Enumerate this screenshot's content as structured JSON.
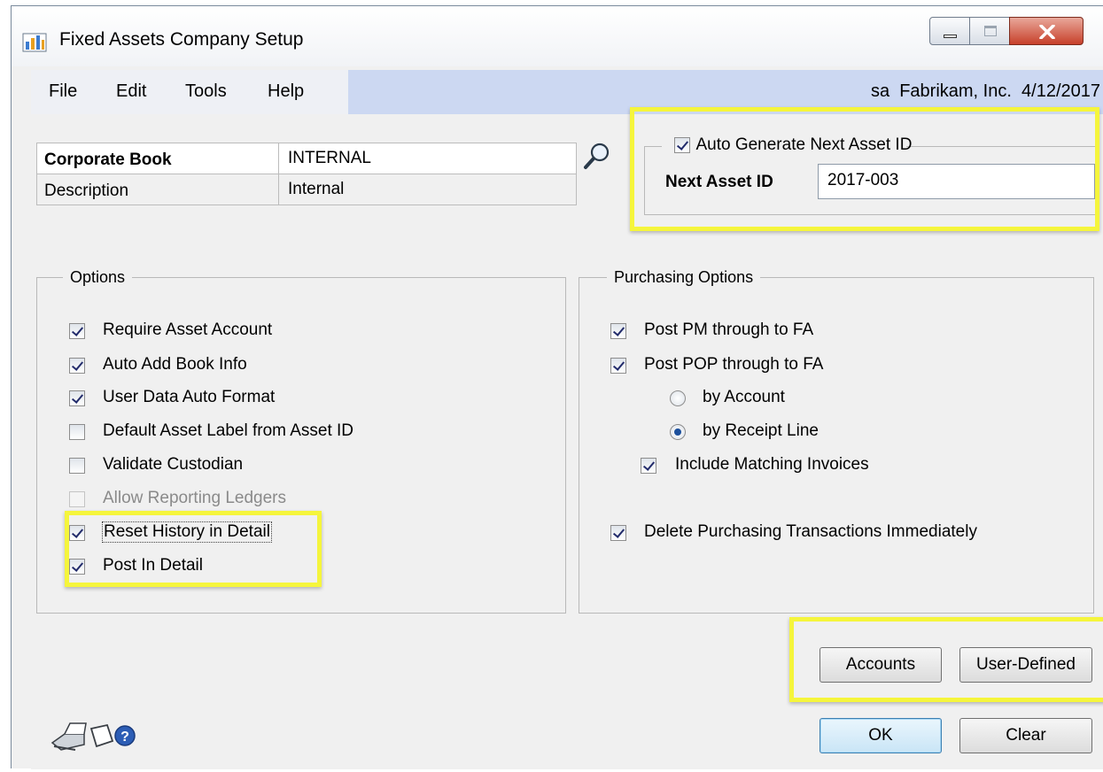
{
  "window": {
    "title": "Fixed Assets Company Setup"
  },
  "menu": {
    "items": [
      "File",
      "Edit",
      "Tools",
      "Help"
    ],
    "status": "sa  Fabrikam, Inc.  4/12/2017"
  },
  "corporate_book": {
    "label": "Corporate Book",
    "value": "INTERNAL",
    "description_label": "Description",
    "description_value": "Internal"
  },
  "asset_id": {
    "auto_generate_label": "Auto Generate Next Asset ID",
    "auto_generate_checked": true,
    "next_label": "Next Asset ID",
    "next_value": "2017-003"
  },
  "options": {
    "title": "Options",
    "items": [
      {
        "label": "Require Asset Account",
        "checked": true,
        "enabled": true
      },
      {
        "label": "Auto Add Book Info",
        "checked": true,
        "enabled": true
      },
      {
        "label": "User Data Auto Format",
        "checked": true,
        "enabled": true
      },
      {
        "label": "Default Asset Label from Asset ID",
        "checked": false,
        "enabled": true
      },
      {
        "label": "Validate Custodian",
        "checked": false,
        "enabled": true
      },
      {
        "label": "Allow Reporting Ledgers",
        "checked": false,
        "enabled": false
      },
      {
        "label": "Reset History in Detail",
        "checked": true,
        "enabled": true
      },
      {
        "label": "Post In Detail",
        "checked": true,
        "enabled": true
      }
    ]
  },
  "purchasing": {
    "title": "Purchasing Options",
    "post_pm": {
      "label": "Post PM through to FA",
      "checked": true
    },
    "post_pop": {
      "label": "Post POP through to FA",
      "checked": true
    },
    "by_account": {
      "label": "by Account",
      "selected": false
    },
    "by_receipt_line": {
      "label": "by Receipt Line",
      "selected": true
    },
    "include_matching": {
      "label": "Include Matching Invoices",
      "checked": true
    },
    "delete_immediately": {
      "label": "Delete Purchasing Transactions Immediately",
      "checked": true
    }
  },
  "buttons": {
    "accounts": "Accounts",
    "user_defined": "User-Defined",
    "ok": "OK",
    "clear": "Clear"
  },
  "colors": {
    "highlight": "#f5f53c",
    "menubar": "#ccd8f2",
    "background": "#f0f0f0"
  },
  "icons": [
    "window-app-icon",
    "lookup-magnifier-icon",
    "printer-icon",
    "note-icon",
    "help-icon"
  ]
}
